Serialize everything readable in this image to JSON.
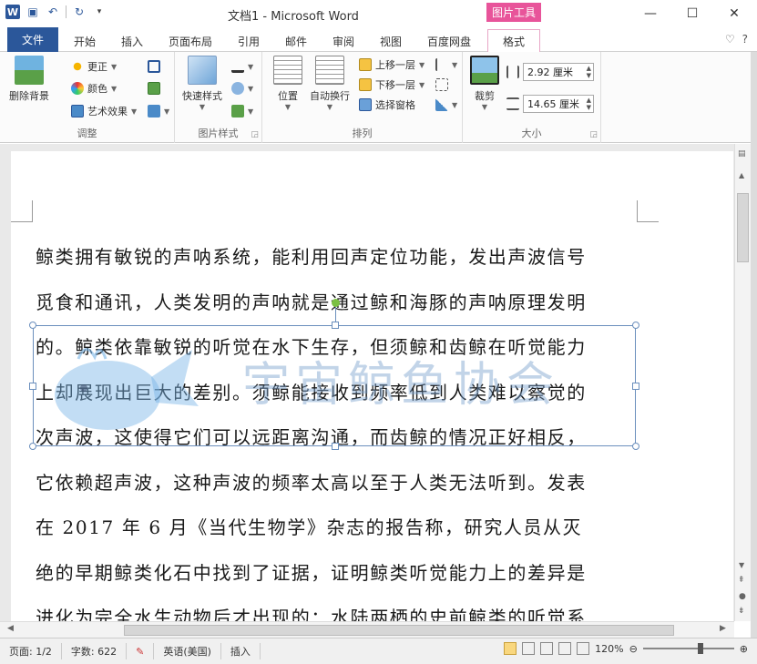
{
  "window": {
    "title": "文档1 - Microsoft Word",
    "context_tools": "图片工具",
    "minimize": "—",
    "maximize": "☐",
    "close": "✕"
  },
  "tabs": {
    "file": "文件",
    "items": [
      "开始",
      "插入",
      "页面布局",
      "引用",
      "邮件",
      "审阅",
      "视图",
      "百度网盘"
    ],
    "format": "格式",
    "right": [
      "♡",
      "?"
    ]
  },
  "ribbon": {
    "adjust": {
      "label": "调整",
      "remove_bg": "删除背景",
      "corrections": "更正",
      "color": "颜色",
      "artistic": "艺术效果"
    },
    "picture_styles": {
      "label": "图片样式",
      "quick_styles": "快速样式"
    },
    "arrange": {
      "label": "排列",
      "position": "位置",
      "wrap_text": "自动换行",
      "bring_forward": "上移一层",
      "send_backward": "下移一层",
      "selection_pane": "选择窗格"
    },
    "size": {
      "label": "大小",
      "crop": "裁剪",
      "height": "2.92 厘米",
      "width": "14.65 厘米"
    }
  },
  "document": {
    "lines": [
      "鲸类拥有敏锐的声呐系统，能利用回声定位功能，发出声波信号",
      "觅食和通讯，人类发明的声呐就是通过鲸和海豚的声呐原理发明",
      "的。鲸类依靠敏锐的听觉在水下生存，但须鲸和齿鲸在听觉能力",
      "上却展现出巨大的差别。须鲸能接收到频率低到人类难以察觉的",
      "次声波，这使得它们可以远距离沟通，而齿鲸的情况正好相反，",
      "它依赖超声波，这种声波的频率太高以至于人类无法听到。发表",
      "在 2017 年 6 月《当代生物学》杂志的报告称，研究人员从灭",
      "绝的早期鲸类化石中找到了证据，证明鲸类听觉能力上的差异是",
      "进化为完全水生动物后才出现的：水陆两栖的史前鲸类的听觉系"
    ],
    "watermark_text": "宇宙鲸鱼协会"
  },
  "status": {
    "page": "页面: 1/2",
    "words": "字数: 622",
    "language": "英语(美国)",
    "mode": "插入",
    "zoom": "120%"
  },
  "colors": {
    "brand": "#2b579a",
    "context_tab": "#e8549a",
    "selection": "#6b8fbd",
    "rotate_handle": "#7ac142"
  }
}
